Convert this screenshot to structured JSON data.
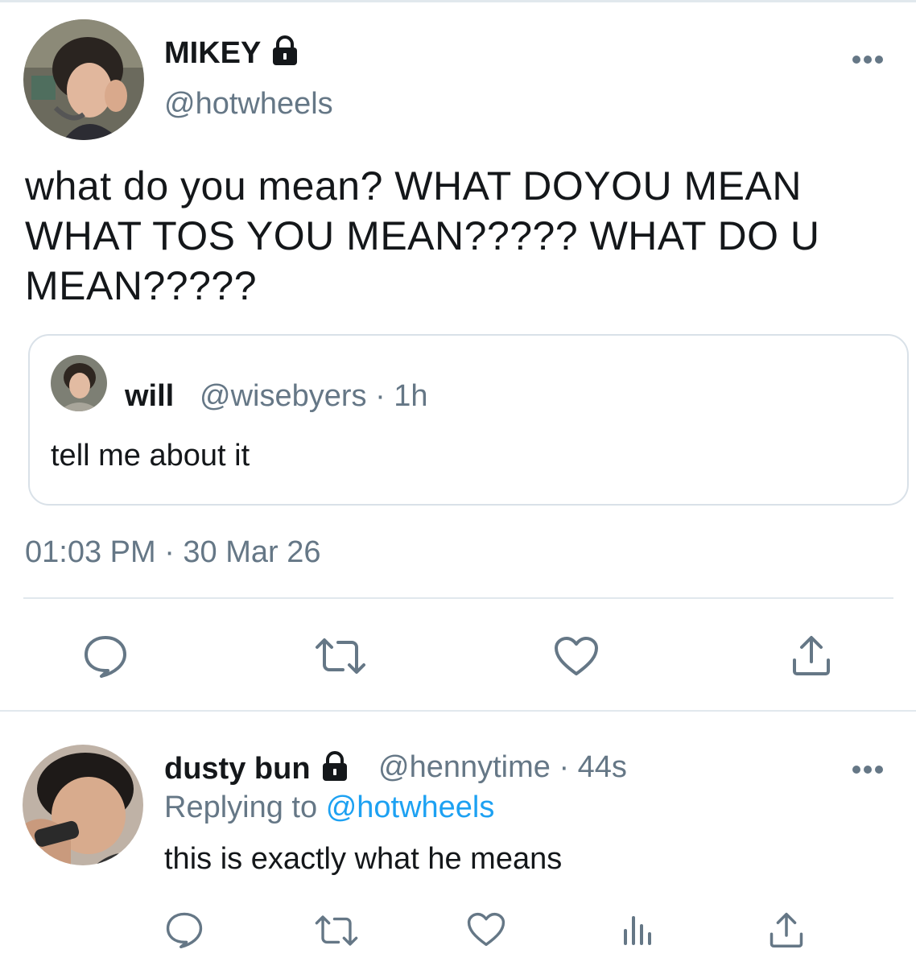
{
  "main_tweet": {
    "display_name": "MIKEY",
    "handle": "@hotwheels",
    "text": "what do you mean? WHAT DOYOU MEAN WHAT TOS YOU MEAN????? WHAT DO U MEAN?????",
    "timestamp": "01:03 PM · 30 Mar 26",
    "more_icon": "more-horizontal-icon",
    "lock_icon": "lock-icon"
  },
  "quoted_tweet": {
    "display_name": "will",
    "handle_time": "@wisebyers · 1h",
    "text": "tell me about it"
  },
  "main_actions": [
    "reply-icon",
    "retweet-icon",
    "like-icon",
    "share-icon"
  ],
  "reply_tweet": {
    "display_name": "dusty bun",
    "handle_time": "@hennytime · 44s",
    "replying_prefix": "Replying to",
    "replying_to": "@hotwheels",
    "text": "this is exactly what he means",
    "actions": [
      "reply-icon",
      "retweet-icon",
      "like-icon",
      "analytics-icon",
      "share-icon"
    ]
  },
  "colors": {
    "text": "#14171a",
    "secondary": "#657786",
    "link": "#1da1f2",
    "border": "#e1e8ed"
  }
}
